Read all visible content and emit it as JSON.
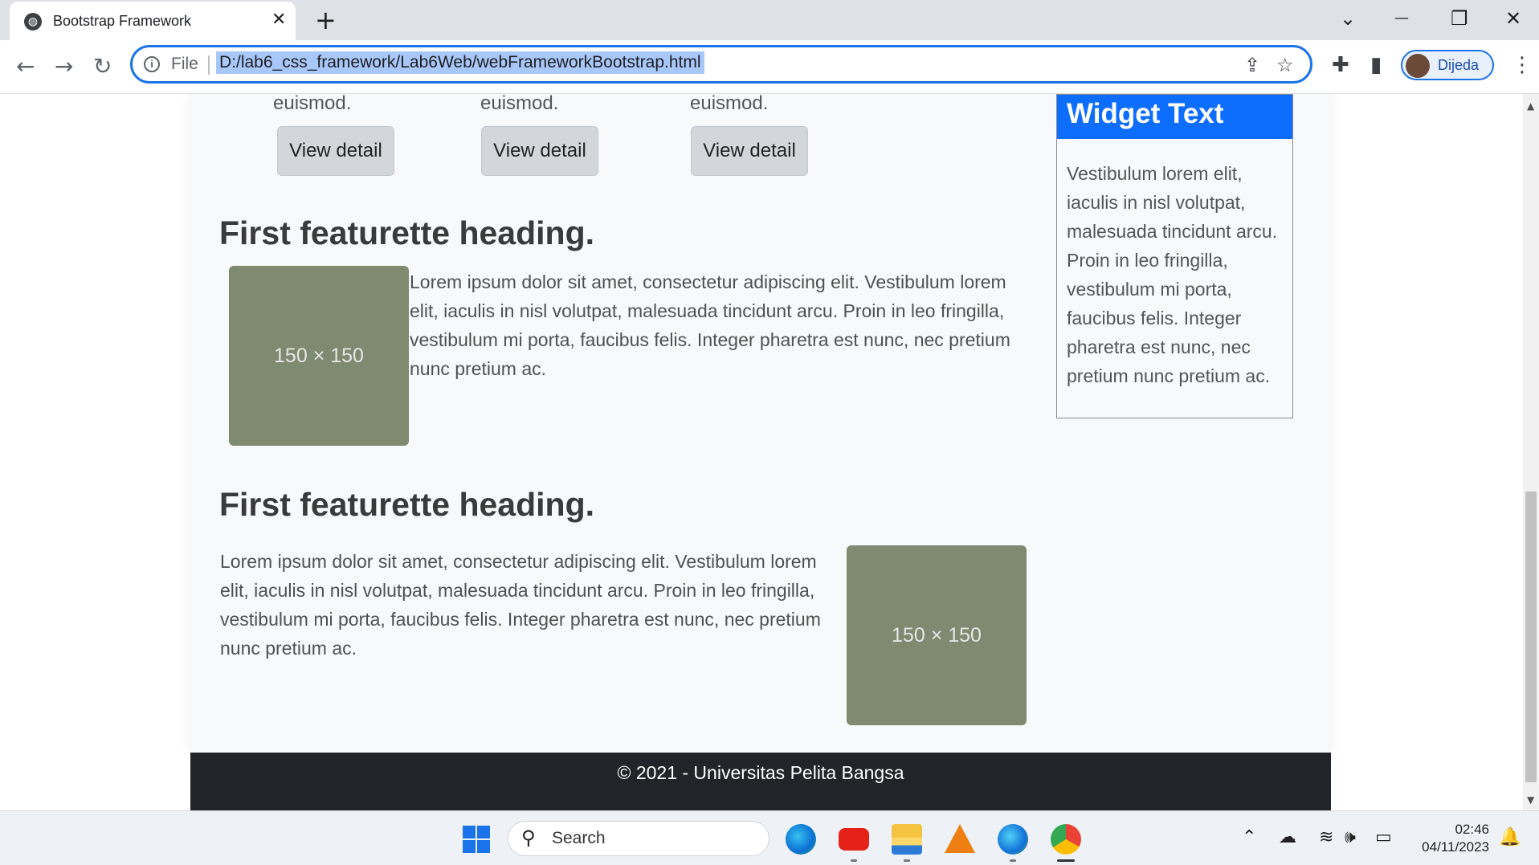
{
  "browser": {
    "tab_title": "Bootstrap Framework",
    "tab_close": "✕",
    "new_tab": "+",
    "file_label": "File",
    "url": "D:/lab6_css_framework/Lab6Web/webFrameworkBootstrap.html",
    "profile_name": "Dijeda",
    "icons": {
      "back": "←",
      "forward": "→",
      "reload": "↻",
      "info": "i",
      "share": "⇪",
      "star": "☆",
      "extensions": "✚",
      "sidepanel": "▮",
      "menu": "⋮",
      "tab_list": "⌄",
      "minimize": "—",
      "restore": "❐",
      "close": "✕"
    }
  },
  "page": {
    "cards": [
      {
        "text": "euismod.",
        "button": "View detail"
      },
      {
        "text": "euismod.",
        "button": "View detail"
      },
      {
        "text": "euismod.",
        "button": "View detail"
      }
    ],
    "featurette1": {
      "heading": "First featurette heading.",
      "image_label": "150 × 150",
      "text": "Lorem ipsum dolor sit amet, consectetur adipiscing elit. Vestibulum lorem elit, iaculis in nisl volutpat, malesuada tincidunt arcu. Proin in leo fringilla, vestibulum mi porta, faucibus felis. Integer pharetra est nunc, nec pretium nunc pretium ac."
    },
    "featurette2": {
      "heading": "First featurette heading.",
      "image_label": "150 × 150",
      "text": "Lorem ipsum dolor sit amet, consectetur adipiscing elit. Vestibulum lorem elit, iaculis in nisl volutpat, malesuada tincidunt arcu. Proin in leo fringilla, vestibulum mi porta, faucibus felis. Integer pharetra est nunc, nec pretium nunc pretium ac."
    },
    "widget": {
      "title": "Widget Text",
      "body": "Vestibulum lorem elit, iaculis in nisl volutpat, malesuada tincidunt arcu. Proin in leo fringilla, vestibulum mi porta, faucibus felis. Integer pharetra est nunc, nec pretium nunc pretium ac."
    },
    "footer": "© 2021 - Universitas Pelita Bangsa"
  },
  "taskbar": {
    "search_placeholder": "Search",
    "search_icon": "⚲",
    "time": "02:46",
    "date": "04/11/2023",
    "tray_icons": {
      "chevron": "⌃",
      "cloud": "☁",
      "wifi": "≋",
      "volume": "🕪",
      "battery": "▭",
      "bell": "🔔"
    }
  },
  "colors": {
    "accent": "#1a73e8",
    "widget_header": "#0d6efd",
    "placeholder": "#7f8a70",
    "footer": "#212529"
  }
}
